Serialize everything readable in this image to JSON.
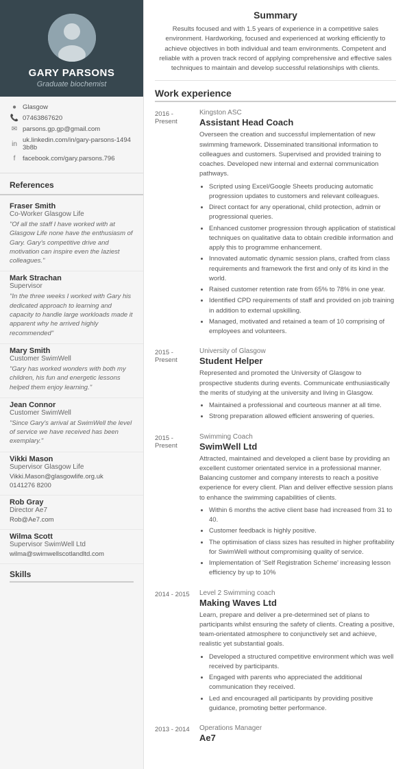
{
  "sidebar": {
    "name": "GARY PARSONS",
    "title": "Graduate biochemist",
    "contact": {
      "location": "Glasgow",
      "phone": "07463867620",
      "email": "parsons.gp.gp@gmail.com",
      "linkedin": "uk.linkedin.com/in/gary-parsons-14943b8b",
      "facebook": "facebook.com/gary.parsons.796"
    },
    "references_title": "References",
    "references": [
      {
        "name": "Fraser Smith",
        "role": "Co-Worker Glasgow Life",
        "quote": "\"Of all the staff I have worked with at Glasgow Life none have the enthusiasm of Gary. Gary's competitive drive and motivation can inspire even the laziest colleagues.\""
      },
      {
        "name": "Mark Strachan",
        "role": "Supervisor",
        "quote": "\"In the three weeks I worked with Gary his dedicated approach to learning and capacity to handle large workloads made it apparent why he arrived highly recommended\""
      },
      {
        "name": "Mary Smith",
        "role": "Customer SwimWell",
        "quote": "\"Gary has worked wonders with both my children, his fun and energetic lessons helped them enjoy learning.\""
      },
      {
        "name": "Jean Connor",
        "role": "Customer SwimWell",
        "quote": "\"Since Gary's arrival at SwimWell the level of service we have received has been exemplary.\""
      },
      {
        "name": "Vikki Mason",
        "role": "Supervisor Glasgow Life",
        "contact1": "Vikki.Mason@glasgowlife.org.uk",
        "contact2": "0141276 8200"
      },
      {
        "name": "Rob Gray",
        "role": "Director Ae7",
        "contact1": "Rob@Ae7.com"
      },
      {
        "name": "Wilma Scott",
        "role": "Supervisor SwimWell Ltd",
        "contact1": "wilma@swimwellscotlandltd.com"
      }
    ]
  },
  "main": {
    "summary_title": "Summary",
    "summary_text": "Results focused and with 1.5 years of experience in a competitive sales environment. Hardworking, focused and experienced at working efficiently to achieve objectives in both individual and team environments. Competent and reliable with a proven track record of applying comprehensive and effective sales techniques to maintain and develop successful relationships with clients.",
    "work_experience_title": "Work experience",
    "jobs": [
      {
        "date": "2016 -\nPresent",
        "company": "Kingston ASC",
        "title": "Assistant Head Coach",
        "desc": "Overseen the creation and successful implementation of new swimming framework. Disseminated transitional information to colleagues and customers. Supervised and provided training to coaches. Developed new internal and external communication pathways.",
        "bullets": [
          "Scripted using Excel/Google Sheets producing automatic progression updates to customers and relevant colleagues.",
          "Direct contact for any operational, child protection, admin or progressional queries.",
          "Enhanced customer progression through application of statistical techniques on qualitative data to obtain credible information and apply this to programme enhancement.",
          "Innovated automatic dynamic session plans, crafted from class requirements and framework the first and only of its kind in the world.",
          "Raised customer retention rate from 65% to 78% in one year.",
          "Identified CPD requirements of staff and provided on job training in addition to external upskilling.",
          "Managed, motivated and retained a team of 10 comprising of employees and volunteers."
        ]
      },
      {
        "date": "2015 -\nPresent",
        "company": "University of Glasgow",
        "title": "Student Helper",
        "desc": "Represented and promoted the University of Glasgow to prospective students during events. Communicate enthusiastically the merits of studying at the university and living in Glasgow.",
        "bullets": [
          "Maintained a professional and courteous manner at all time.",
          "Strong preparation allowed efficient answering of queries."
        ]
      },
      {
        "date": "2015 -\nPresent",
        "company": "SwimWell Ltd",
        "title": "Swimming Coach",
        "desc": "Attracted, maintained and developed a client base by providing an excellent customer orientated service in a professional manner. Balancing customer and company interests to reach a positive experience for every client. Plan and deliver effective session plans to enhance the swimming capabilities of clients.",
        "bullets": [
          "Within 6 months the active client base had increased from 31 to 40.",
          "Customer feedback is highly positive.",
          "The optimisation of class sizes has resulted in higher profitability for SwimWell without compromising quality of service.",
          "Implementation of 'Self Registration Scheme' increasing lesson efficiency by up to 10%"
        ]
      },
      {
        "date": "2014 - 2015",
        "company": "Making Waves Ltd",
        "title": "Level 2 Swimming coach",
        "desc": "Learn, prepare and deliver a pre-determined set of plans to participants whilst ensuring the safety of clients. Creating a positive, team-orientated atmosphere to conjunctively set and achieve, realistic yet substantial goals.",
        "bullets": [
          "Developed a structured competitive environment which was well received by participants.",
          "Engaged with parents who appreciated the additional communication they received.",
          "Led and encouraged all participants by providing positive guidance, promoting better performance."
        ]
      },
      {
        "date": "2013 - 2014",
        "company": "Ae7",
        "title": "Operations Manager",
        "desc": "",
        "bullets": []
      }
    ],
    "skills_title": "Skills"
  }
}
